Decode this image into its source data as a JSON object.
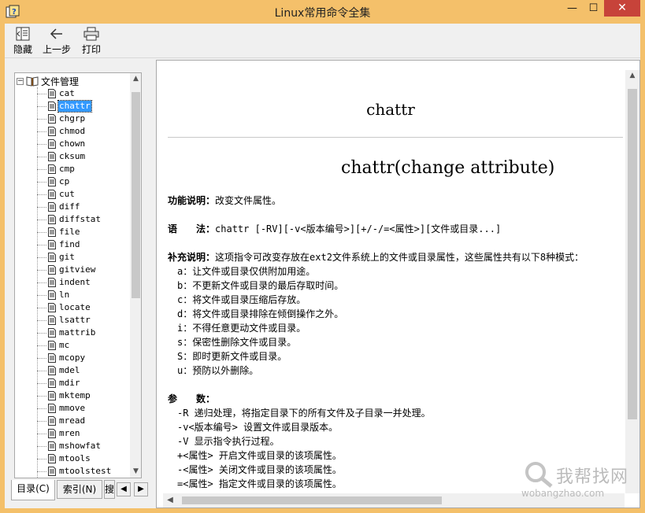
{
  "window": {
    "title": "Linux常用命令全集",
    "minimize": "—",
    "maximize": "☐",
    "close": "✕"
  },
  "toolbar": {
    "hide_label": "隐藏",
    "back_label": "上一步",
    "print_label": "打印"
  },
  "tree": {
    "root_label": "文件管理",
    "expander": "−",
    "items": [
      "cat",
      "chattr",
      "chgrp",
      "chmod",
      "chown",
      "cksum",
      "cmp",
      "cp",
      "cut",
      "diff",
      "diffstat",
      "file",
      "find",
      "git",
      "gitview",
      "indent",
      "ln",
      "locate",
      "lsattr",
      "mattrib",
      "mc",
      "mcopy",
      "mdel",
      "mdir",
      "mktemp",
      "mmove",
      "mread",
      "mren",
      "mshowfat",
      "mtools",
      "mtoolstest"
    ],
    "selected_index": 1
  },
  "tabs": {
    "contents": "目录(C)",
    "index": "索引(N)",
    "search": "搜"
  },
  "content": {
    "heading": "chattr",
    "subheading": "chattr(change attribute)",
    "func_label": "功能说明：",
    "func_text": "改变文件属性。",
    "syntax_label": "语　　法：",
    "syntax_text": "chattr [-RV][-v<版本编号>][+/-/=<属性>][文件或目录...]",
    "supp_label": "补充说明：",
    "supp_text": "这项指令可改变存放在ext2文件系统上的文件或目录属性，这些属性共有以下8种模式：",
    "modes": [
      "a：让文件或目录仅供附加用途。",
      "b：不更新文件或目录的最后存取时间。",
      "c：将文件或目录压缩后存放。",
      "d：将文件或目录排除在倾倒操作之外。",
      "i：不得任意更动文件或目录。",
      "s：保密性删除文件或目录。",
      "S：即时更新文件或目录。",
      "u：预防以外删除。"
    ],
    "params_label": "参　　数：",
    "params": [
      "-R  递归处理，将指定目录下的所有文件及子目录一并处理。",
      "-v<版本编号>  设置文件或目录版本。",
      "-V  显示指令执行过程。",
      "+<属性>  开启文件或目录的该项属性。",
      "-<属性>  关闭文件或目录的该项属性。",
      "=<属性>  指定文件或目录的该项属性。"
    ]
  },
  "watermark": {
    "text": "我帮找网",
    "url": "wobangzhao.com"
  },
  "colors": {
    "titlebar": "#f4c06a",
    "close": "#c7433a",
    "selection": "#3399ff"
  }
}
